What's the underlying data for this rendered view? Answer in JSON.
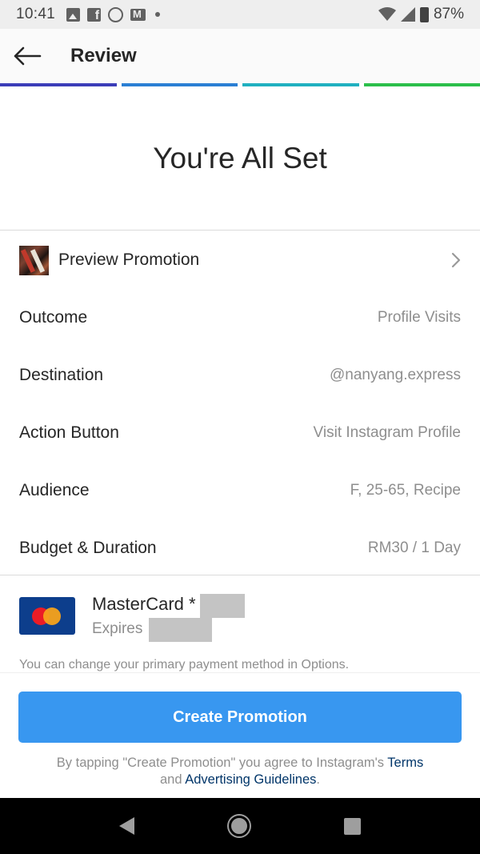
{
  "status_bar": {
    "time": "10:41",
    "battery": "87%"
  },
  "header": {
    "title": "Review"
  },
  "progress_colors": [
    "#3b3db8",
    "#2a7fd4",
    "#1fb0c0",
    "#2bbf4a"
  ],
  "hero": {
    "title": "You're All Set"
  },
  "rows": [
    {
      "label": "Preview Promotion",
      "value": ""
    },
    {
      "label": "Outcome",
      "value": "Profile Visits"
    },
    {
      "label": "Destination",
      "value": "@nanyang.express"
    },
    {
      "label": "Action Button",
      "value": "Visit Instagram Profile"
    },
    {
      "label": "Audience",
      "value": "F, 25-65, Recipe"
    },
    {
      "label": "Budget & Duration",
      "value": "RM30 / 1 Day"
    }
  ],
  "payment": {
    "card_name": "MasterCard *",
    "expires_label": "Expires",
    "note": "You can change your primary payment method in Options."
  },
  "create_button": "Create Promotion",
  "terms": {
    "prefix": "By tapping \"Create Promotion\" you agree to Instagram's ",
    "terms_link": "Terms",
    "middle": "and ",
    "guidelines_link": "Advertising Guidelines",
    "suffix": "."
  },
  "colors": {
    "accent": "#3897f0",
    "link": "#003569"
  }
}
